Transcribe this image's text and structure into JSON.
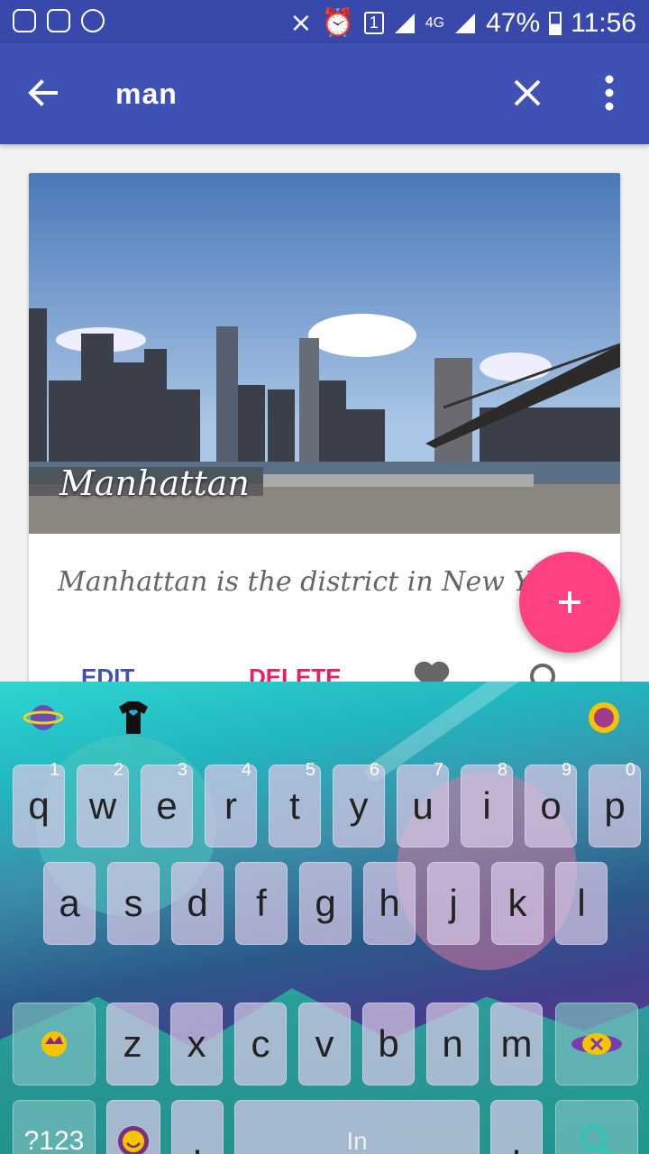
{
  "status_bar": {
    "network": "4G",
    "battery": "47%",
    "time": "11:56",
    "sim": "1"
  },
  "app_bar": {
    "search_query": "man"
  },
  "card": {
    "title": "Manhattan",
    "description": "Manhattan is the district in New Y",
    "edit_label": "EDIT",
    "delete_label": "DELETE"
  },
  "fab": {
    "label": "+"
  },
  "keyboard": {
    "row1": [
      {
        "ch": "q",
        "num": "1"
      },
      {
        "ch": "w",
        "num": "2"
      },
      {
        "ch": "e",
        "num": "3"
      },
      {
        "ch": "r",
        "num": "4"
      },
      {
        "ch": "t",
        "num": "5"
      },
      {
        "ch": "y",
        "num": "6"
      },
      {
        "ch": "u",
        "num": "7"
      },
      {
        "ch": "i",
        "num": "8"
      },
      {
        "ch": "o",
        "num": "9"
      },
      {
        "ch": "p",
        "num": "0"
      }
    ],
    "row2": [
      "a",
      "s",
      "d",
      "f",
      "g",
      "h",
      "j",
      "k",
      "l"
    ],
    "row3": [
      "z",
      "x",
      "c",
      "v",
      "b",
      "n",
      "m"
    ],
    "symbols_label": "?123",
    "comma_label": ",",
    "space_label": "In",
    "period_label": ".",
    "ellipsis": "..."
  }
}
